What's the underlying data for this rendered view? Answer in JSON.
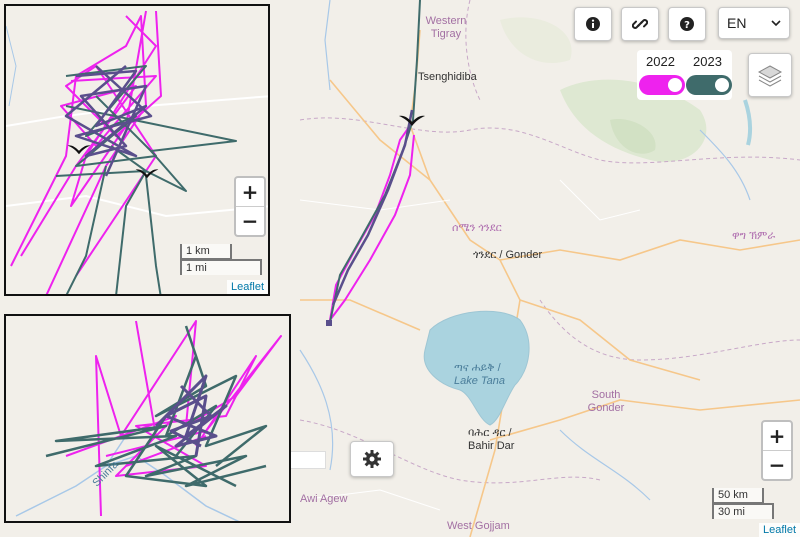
{
  "map_labels": {
    "western_tigray": "Western Tigray",
    "tsenghidiba": "Tsenghidiba",
    "amhara_region": "ሰሜን ጎንደር",
    "gonder": "ጎንደር / Gonder",
    "wag_himra": "ዋግ ኽምራ",
    "lake_tana_am": "ጣና ሐይቅ /",
    "lake_tana": "Lake Tana",
    "south_gonder": "South Gonder",
    "bahir_dar_am": "ባሕር ዳር /",
    "bahir_dar": "Bahir Dar",
    "awi_agew": "Awi Agew",
    "west_gojjam": "West Gojjam",
    "shinfa": "Shinfa"
  },
  "controls": {
    "language": "EN",
    "year_a": "2022",
    "year_b": "2023",
    "zoom_in": "+",
    "zoom_out": "−"
  },
  "colors": {
    "year_2022": "#ee22ee",
    "year_2023": "#3f6b6b",
    "overlap": "#5a4f8c"
  },
  "main_scale": {
    "km": "50 km",
    "mi": "30 mi"
  },
  "inset_top_scale": {
    "km": "1 km",
    "mi": "1 mi"
  },
  "attribution": "Leaflet",
  "inset_top_attribution": "Leaflet",
  "icons": [
    "info-icon",
    "link-icon",
    "help-icon",
    "chevron-down-icon",
    "layers-icon",
    "gear-icon",
    "bird-icon"
  ]
}
